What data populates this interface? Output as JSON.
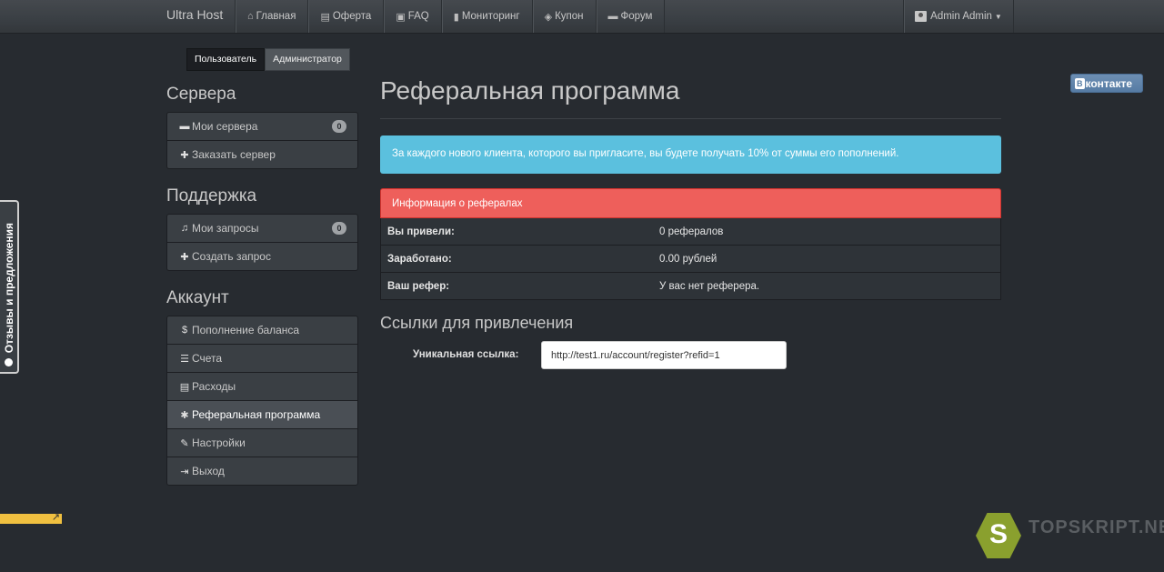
{
  "navbar": {
    "brand": "Ultra Host",
    "items": [
      {
        "label": "Главная",
        "icon": "home-icon",
        "glyph": "⌂"
      },
      {
        "label": "Оферта",
        "icon": "document-icon",
        "glyph": "▤"
      },
      {
        "label": "FAQ",
        "icon": "book-icon",
        "glyph": "▣"
      },
      {
        "label": "Мониторинг",
        "icon": "bar-chart-icon",
        "glyph": "▮"
      },
      {
        "label": "Купон",
        "icon": "tag-icon",
        "glyph": "◈"
      },
      {
        "label": "Форум",
        "icon": "comment-icon",
        "glyph": "▬"
      }
    ],
    "user": "Admin Admin"
  },
  "roles": {
    "user": "Пользователь",
    "admin": "Администратор"
  },
  "sidebar": {
    "servers_title": "Сервера",
    "servers": [
      {
        "label": "Мои сервера",
        "badge": "0",
        "glyph": "▬"
      },
      {
        "label": "Заказать сервер",
        "glyph": "✚"
      }
    ],
    "support_title": "Поддержка",
    "support": [
      {
        "label": "Мои запросы",
        "badge": "0",
        "glyph": "♫"
      },
      {
        "label": "Создать запрос",
        "glyph": "✚"
      }
    ],
    "account_title": "Аккаунт",
    "account": [
      {
        "label": "Пополнение баланса",
        "glyph": "$"
      },
      {
        "label": "Счета",
        "glyph": "☰"
      },
      {
        "label": "Расходы",
        "glyph": "▤"
      },
      {
        "label": "Реферальная программа",
        "glyph": "✱"
      },
      {
        "label": "Настройки",
        "glyph": "✎"
      },
      {
        "label": "Выход",
        "glyph": "⇥"
      }
    ]
  },
  "feedback": "Отзывы и предложения",
  "main": {
    "title": "Реферальная программа",
    "info": "За каждого нового клиента, которого вы пригласите, вы будете получать 10% от суммы его пополнений.",
    "panel_title": "Информация о рефералах",
    "rows": [
      {
        "k": "Вы привели:",
        "v": "0 рефералов"
      },
      {
        "k": "Заработано:",
        "v": "0.00 рублей"
      },
      {
        "k": "Ваш рефер:",
        "v": "У вас нет реферера."
      }
    ],
    "links_title": "Ссылки для привлечения",
    "link_label": "Уникальная ссылка:",
    "link_value": "http://test1.ru/account/register?refid=1"
  },
  "vk": {
    "box": "В",
    "label": "контакте"
  },
  "watermark": {
    "letter": "S",
    "text": "TOPSKRIPT.NET"
  },
  "colors": {
    "info": "#5bc0de",
    "danger": "#ee5f5b",
    "background": "#272b30"
  }
}
